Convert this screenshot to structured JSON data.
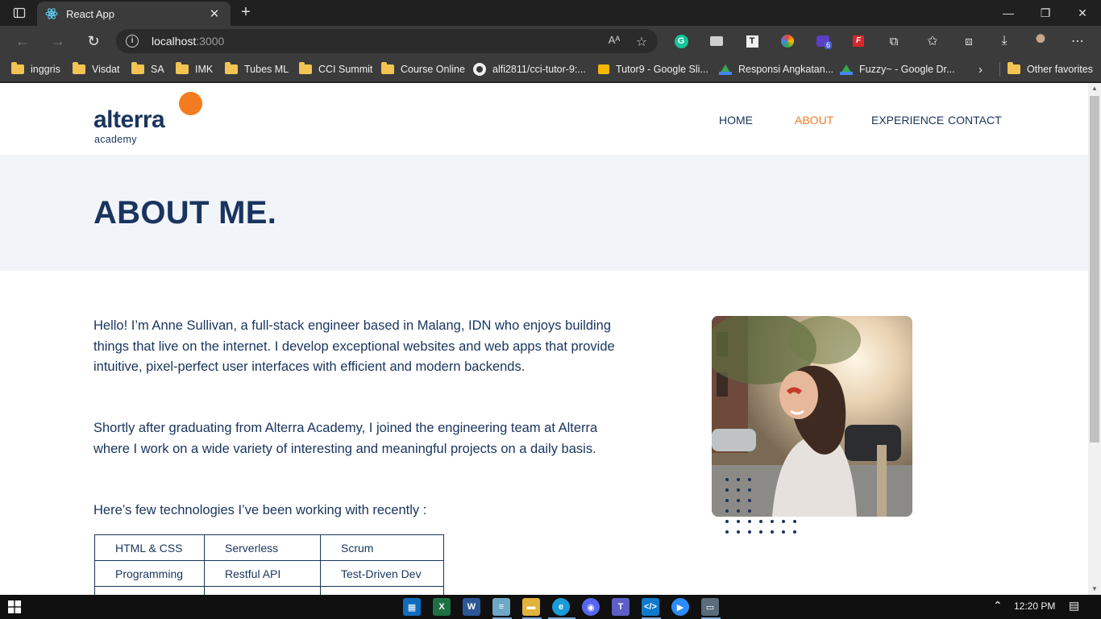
{
  "browser": {
    "tab_title": "React App",
    "url_host": "localhost",
    "url_port": ":3000",
    "read_aloud_label": "Aᴬ",
    "bookmarks": [
      {
        "label": "inggris",
        "icon": "folder-icon"
      },
      {
        "label": "Visdat",
        "icon": "folder-icon"
      },
      {
        "label": "SA",
        "icon": "folder-icon"
      },
      {
        "label": "IMK",
        "icon": "folder-icon"
      },
      {
        "label": "Tubes ML",
        "icon": "folder-icon"
      },
      {
        "label": "CCI Summit",
        "icon": "folder-icon"
      },
      {
        "label": "Course Online",
        "icon": "folder-icon"
      },
      {
        "label": "alfi2811/cci-tutor-9:...",
        "icon": "github-icon"
      },
      {
        "label": "Tutor9 - Google Sli...",
        "icon": "slides-icon"
      },
      {
        "label": "Responsi Angkatan...",
        "icon": "drive-icon"
      },
      {
        "label": "Fuzzy~ - Google Dr...",
        "icon": "drive-icon"
      }
    ],
    "other_favorites": "Other favorites",
    "extension_badge": "6"
  },
  "site": {
    "logo_word": "alterra",
    "logo_sub": "academy",
    "nav": [
      {
        "label": "HOME",
        "active": false
      },
      {
        "label": "ABOUT",
        "active": true
      },
      {
        "label": "EXPERIENCE",
        "active": false
      },
      {
        "label": "CONTACT",
        "active": false
      }
    ],
    "hero_title": "ABOUT ME.",
    "paragraphs": [
      "Hello! I’m Anne Sullivan, a full-stack engineer based in Malang, IDN who enjoys building things that live on the internet. I develop exceptional websites and web apps that provide intuitive, pixel-perfect user interfaces with efficient and modern backends.",
      "Shortly after graduating from Alterra Academy, I joined the engineering team at Alterra where I work on a wide variety of interesting and meaningful projects on a daily basis.",
      "Here’s few technologies I’ve been working with recently :"
    ],
    "tech_table": [
      [
        "HTML & CSS",
        "Serverless",
        "Scrum"
      ],
      [
        "Programming",
        "Restful API",
        "Test-Driven Dev"
      ],
      [
        "",
        "",
        ""
      ]
    ],
    "photo_alt": "profile photo",
    "accent_color": "#f47c20",
    "navy_color": "#19345e"
  },
  "taskbar": {
    "clock": "12:20 PM"
  }
}
